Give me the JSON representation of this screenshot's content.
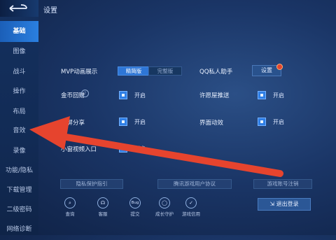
{
  "header": {
    "title": "设置"
  },
  "sidebar": {
    "items": [
      {
        "label": "基础",
        "active": true
      },
      {
        "label": "图像"
      },
      {
        "label": "战斗"
      },
      {
        "label": "操作"
      },
      {
        "label": "布局"
      },
      {
        "label": "音效"
      },
      {
        "label": "录像"
      },
      {
        "label": "功能/隐私"
      },
      {
        "label": "下载管理"
      },
      {
        "label": "二级密码"
      },
      {
        "label": "网络诊断"
      }
    ]
  },
  "settings": {
    "mvp": {
      "label": "MVP动画展示",
      "options": [
        "精简版",
        "完整版"
      ],
      "selected": "精简版"
    },
    "qq": {
      "label": "QQ私人助手",
      "button": "设置"
    },
    "coin": {
      "label": "金币回赠",
      "value": "开启"
    },
    "reminder": {
      "label": "许愿屋推送",
      "value": "开启"
    },
    "screenshot": {
      "label": "截屏分享",
      "value": "开启"
    },
    "ui_anim": {
      "label": "界面动效",
      "value": "开启"
    },
    "mini_video": {
      "label": "小窗视频入口",
      "value": "开启"
    }
  },
  "bottom_links": [
    "隐私保护指引",
    "腾讯游戏用户协议",
    "游戏账号注销"
  ],
  "bottom_icons": [
    {
      "label": "查询",
      "icon": "search-icon",
      "glyph": "⌕"
    },
    {
      "label": "客服",
      "icon": "headset-icon",
      "glyph": "☊"
    },
    {
      "label": "提交",
      "icon": "bug-icon",
      "glyph": "Bug"
    },
    {
      "label": "成长守护",
      "icon": "ring-icon",
      "glyph": "◯"
    },
    {
      "label": "游戏信用",
      "icon": "shield-icon",
      "glyph": "✓"
    }
  ],
  "logout": {
    "label": "退出登录"
  },
  "colors": {
    "accent": "#2e76d6",
    "arrow": "#e6442e"
  }
}
